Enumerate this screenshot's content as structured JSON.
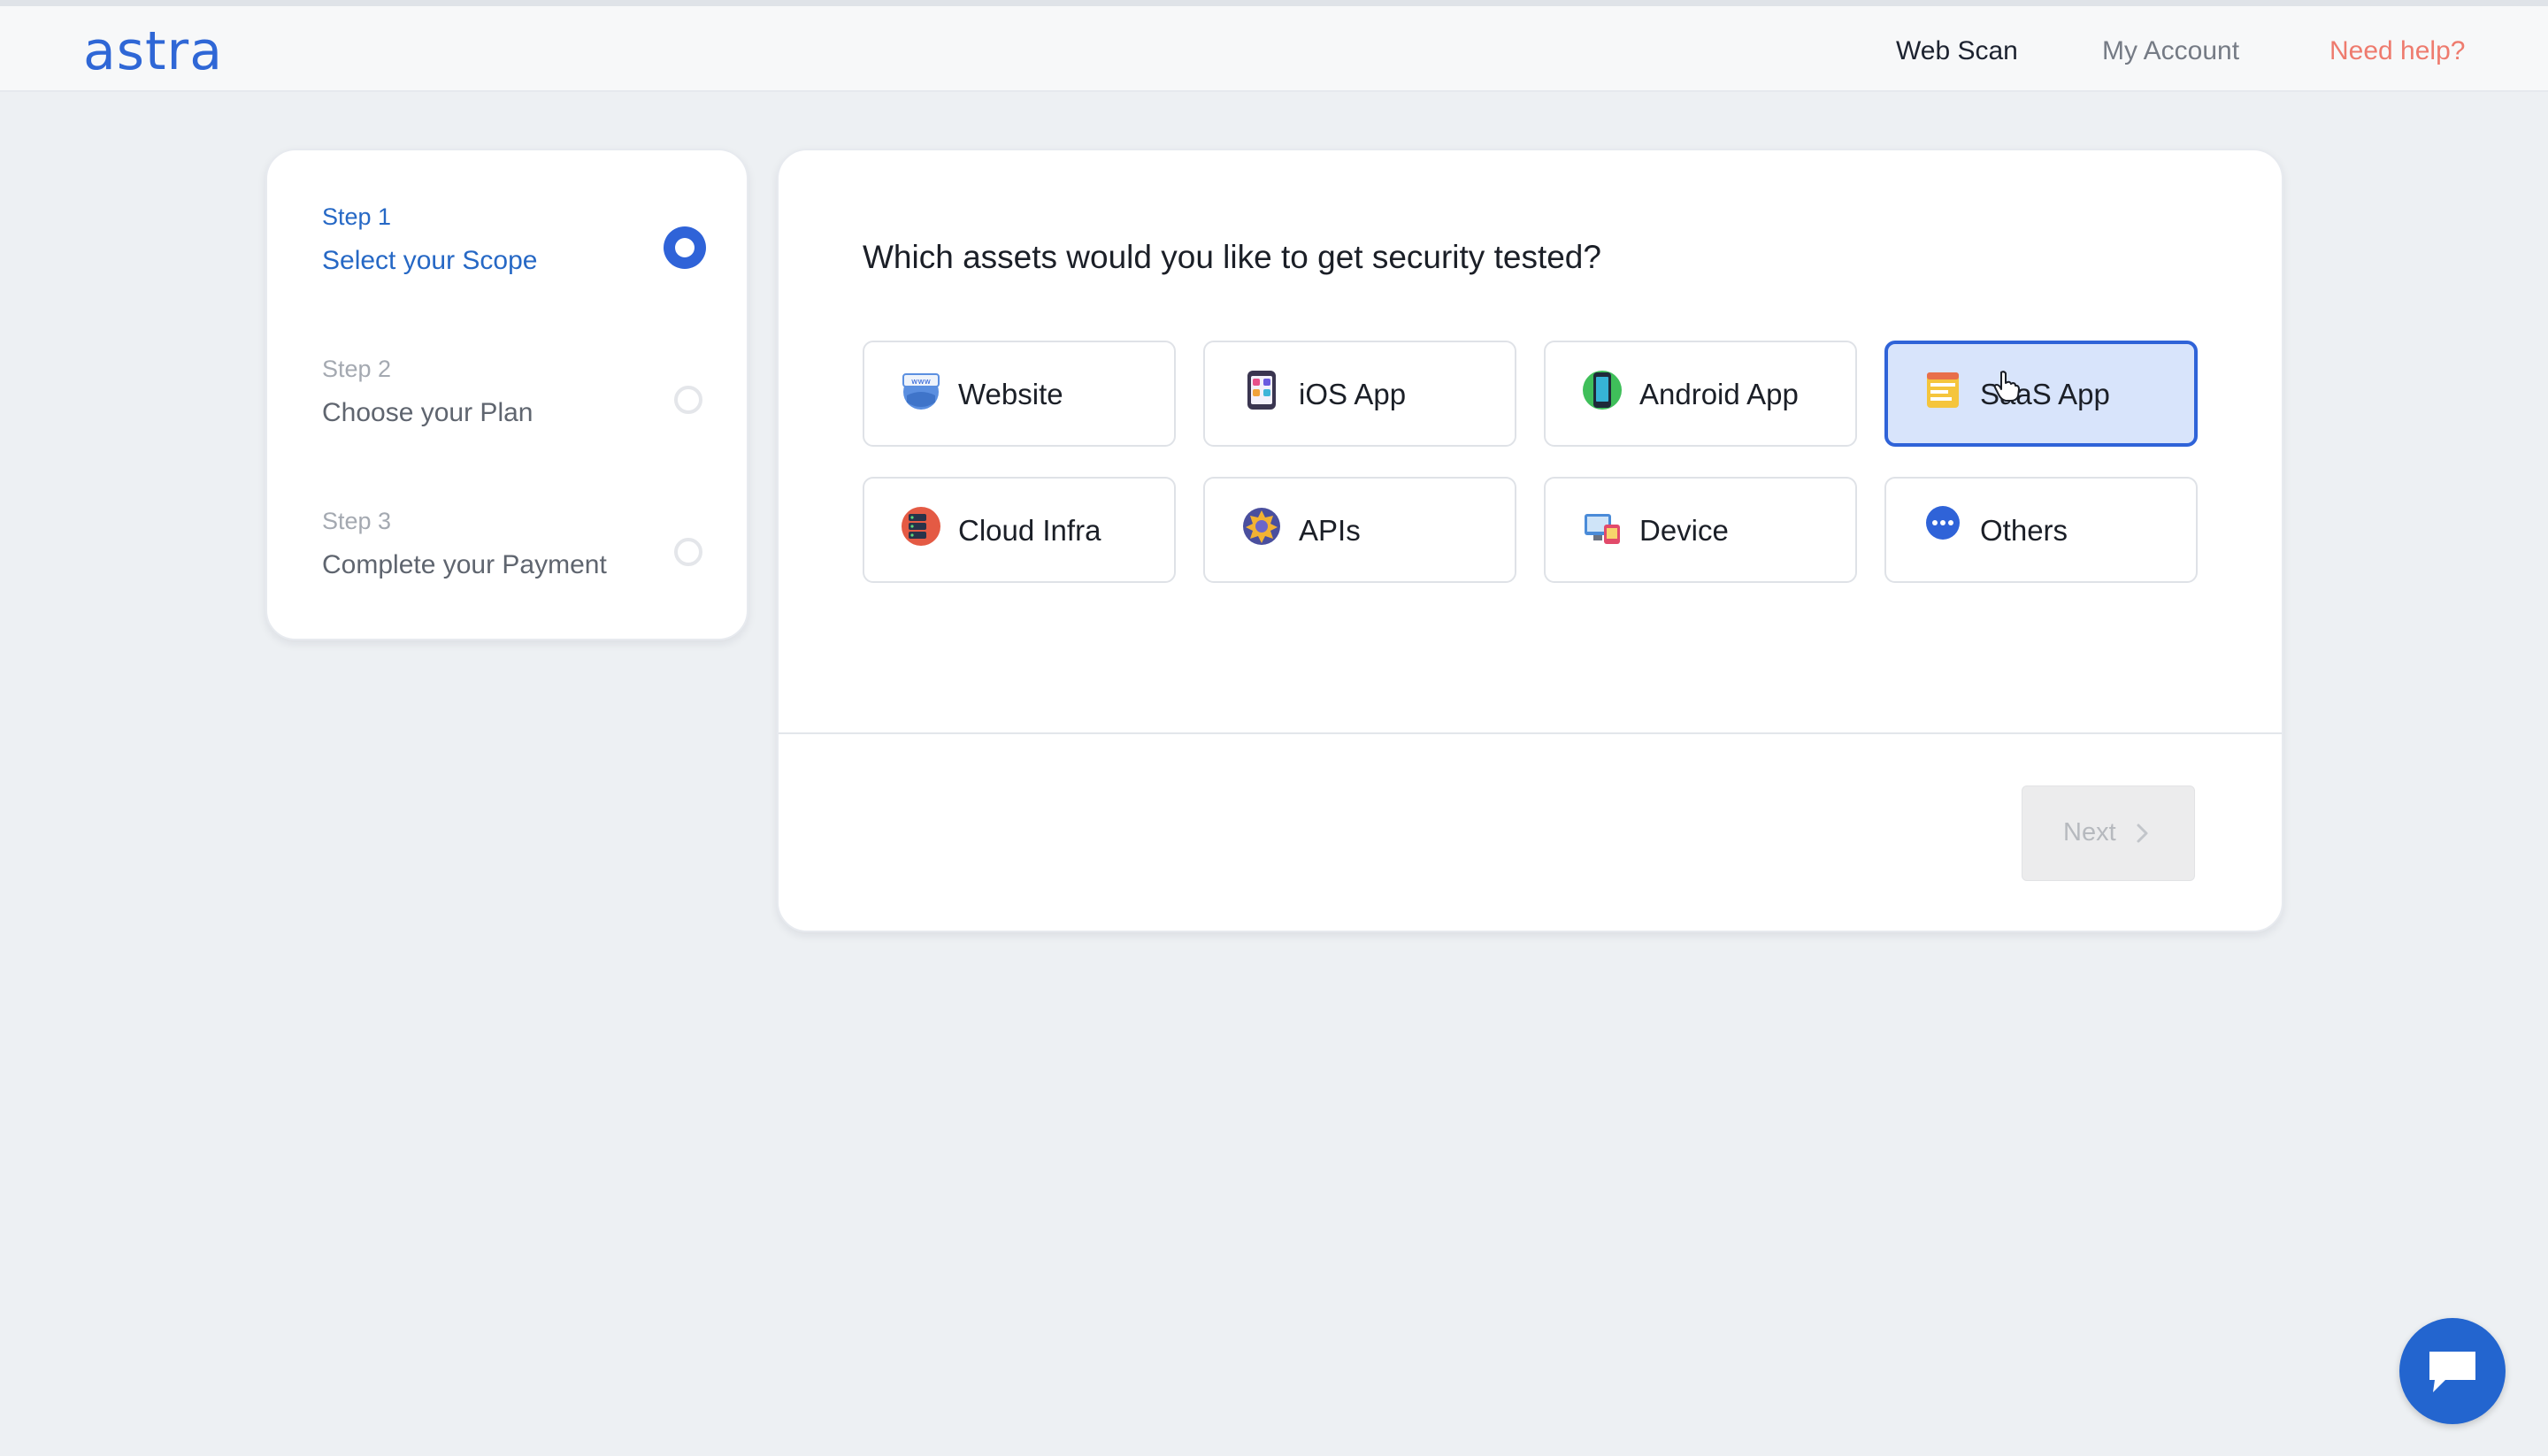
{
  "header": {
    "logo": "astra",
    "nav": {
      "web_scan": "Web Scan",
      "my_account": "My Account",
      "need_help": "Need help?"
    }
  },
  "steps": [
    {
      "number": "Step 1",
      "name": "Select your Scope",
      "state": "active"
    },
    {
      "number": "Step 2",
      "name": "Choose your Plan",
      "state": "pending"
    },
    {
      "number": "Step 3",
      "name": "Complete your Payment",
      "state": "pending"
    }
  ],
  "main": {
    "question": "Which assets would you like to get security tested?",
    "assets": [
      {
        "label": "Website",
        "icon": "website-globe-icon",
        "selected": false
      },
      {
        "label": "iOS App",
        "icon": "ios-app-icon",
        "selected": false
      },
      {
        "label": "Android App",
        "icon": "android-phone-icon",
        "selected": false
      },
      {
        "label": "SaaS App",
        "icon": "saas-app-icon",
        "selected": true
      },
      {
        "label": "Cloud Infra",
        "icon": "cloud-infra-icon",
        "selected": false
      },
      {
        "label": "APIs",
        "icon": "api-gear-icon",
        "selected": false
      },
      {
        "label": "Device",
        "icon": "device-icon",
        "selected": false
      },
      {
        "label": "Others",
        "icon": "more-dots-icon",
        "selected": false
      }
    ],
    "next_label": "Next"
  },
  "colors": {
    "accent": "#2f63d8",
    "help_link": "#ee7b6e",
    "selected_bg": "#d8e4fb",
    "background": "#edf0f3"
  }
}
